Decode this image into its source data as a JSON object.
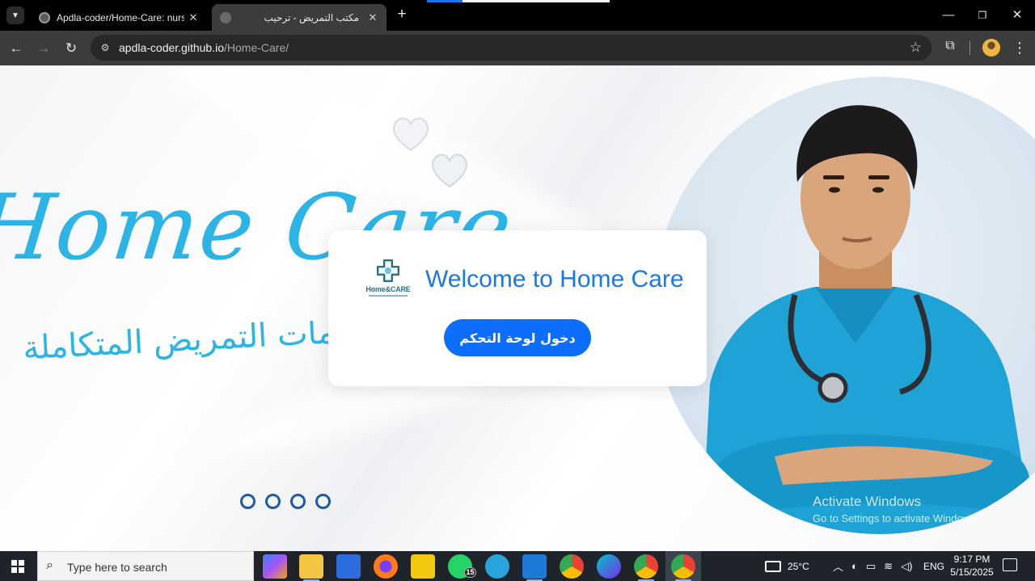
{
  "browser": {
    "tabs": [
      {
        "title": "Apdla-coder/Home-Care: nurse",
        "active": false
      },
      {
        "title": "مكتب التمريض - ترحيب",
        "active": true
      }
    ],
    "url": {
      "host": "apdla-coder.github.io",
      "path": "/Home-Care/"
    }
  },
  "hero": {
    "script_text": "Home Care",
    "arabic_tagline": "خدمات التمريض المتكاملة"
  },
  "welcome_card": {
    "logo_text": "Home&CARE",
    "title": "Welcome to Home Care",
    "button_label": "دخول لوحة التحكم"
  },
  "carousel": {
    "dot_count": 4
  },
  "watermark": {
    "title": "Activate Windows",
    "subtitle": "Go to Settings to activate Windows."
  },
  "taskbar": {
    "search_placeholder": "Type here to search",
    "apps": [
      "copilot-icon",
      "file-explorer-icon",
      "microsoft-store-icon",
      "firefox-icon",
      "power-bi-icon",
      "whatsapp-icon",
      "telegram-icon",
      "vscode-icon",
      "chrome-icon",
      "canva-icon",
      "chrome-profile-icon",
      "chrome-profile-active-icon"
    ],
    "whatsapp_badge": "15",
    "temperature": "25°C",
    "language": "ENG",
    "time": "9:17 PM",
    "date": "5/15/2025"
  },
  "colors": {
    "accent_blue": "#1a78e5",
    "button_blue": "#0d6efd",
    "script_cyan": "#2cb4e6",
    "scrubs": "#1fa3d6"
  }
}
